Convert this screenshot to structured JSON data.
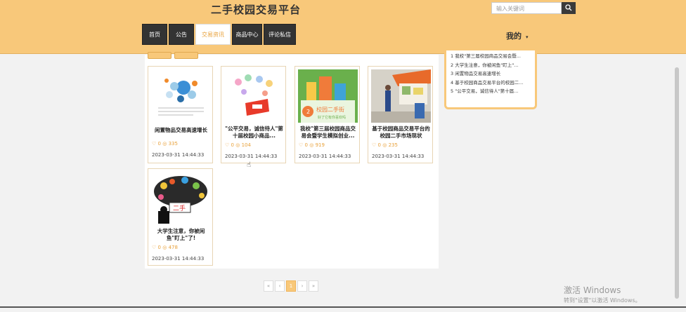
{
  "header": {
    "site_title": "二手校园交易平台",
    "search_placeholder": "输入关键词",
    "nav": [
      {
        "label": "首页"
      },
      {
        "label": "公告"
      },
      {
        "label": "交易资讯"
      },
      {
        "label": "商品中心"
      },
      {
        "label": "评论私信"
      }
    ],
    "user_menu": "我的"
  },
  "cards": [
    {
      "title": "闲置物品交易高速增长",
      "likes": "0",
      "views": "335",
      "date": "2023-03-31 14:44:33"
    },
    {
      "title": "\"公平交易，诚信待人\"第十届校园小商品...",
      "likes": "0",
      "views": "104",
      "date": "2023-03-31 14:44:33"
    },
    {
      "title": "我校\"第三届校园商品交易会暨学生模拟创业...",
      "likes": "0",
      "views": "919",
      "date": "2023-03-31 14:44:33"
    },
    {
      "title": "基于校园商品交易平台的校园二手市场现状",
      "likes": "0",
      "views": "235",
      "date": "2023-03-31 14:44:33"
    },
    {
      "title": "大学生注意，你被闲鱼\"盯上\"了!",
      "likes": "0",
      "views": "478",
      "date": "2023-03-31 14:44:33"
    }
  ],
  "card3_banner": "校园二手街",
  "card3_banner_sub": "好了它有你喜欢吗",
  "card5_banner": "二手",
  "sidebar": [
    "1 我校\"第三届校园商品交易会暨...",
    "2 大学生注意，你被闲鱼\"盯上\"...",
    "3 闲置物品交易高速增长",
    "4 基于校园商品交易平台的校园二...",
    "5 \"公平交易，诚信待人\"第十届..."
  ],
  "pager": [
    "«",
    "‹",
    "1",
    "›",
    "»"
  ],
  "watermark": {
    "line1": "激活 Windows",
    "line2": "转到\"设置\"以激活 Windows。"
  },
  "colors": {
    "accent": "#f8c87a",
    "nav_bg": "#333333"
  }
}
